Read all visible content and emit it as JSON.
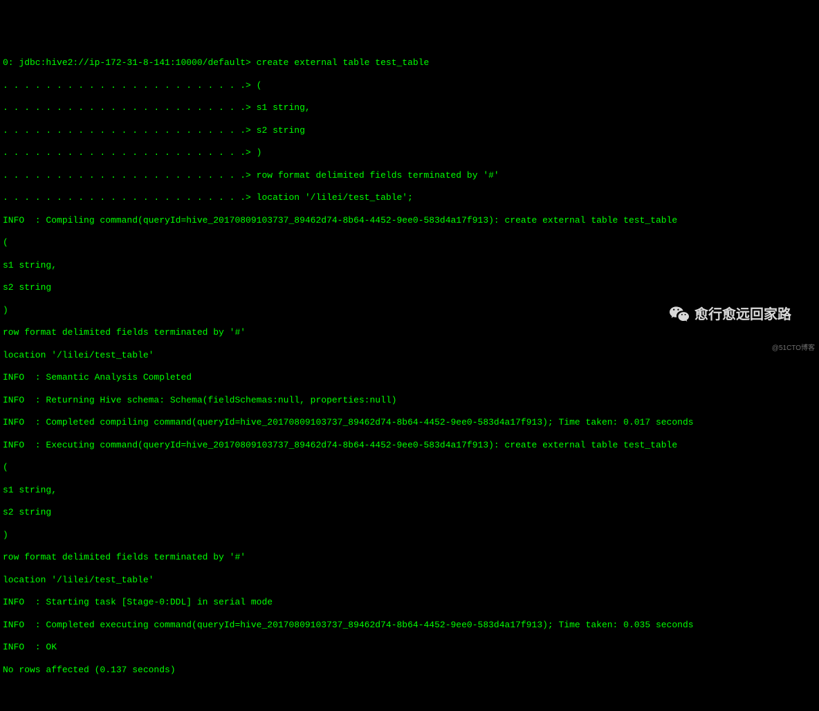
{
  "terminal": {
    "lines": [
      "0: jdbc:hive2://ip-172-31-8-141:10000/default> create external table test_table",
      ". . . . . . . . . . . . . . . . . . . . . . .> (",
      ". . . . . . . . . . . . . . . . . . . . . . .> s1 string,",
      ". . . . . . . . . . . . . . . . . . . . . . .> s2 string",
      ". . . . . . . . . . . . . . . . . . . . . . .> )",
      ". . . . . . . . . . . . . . . . . . . . . . .> row format delimited fields terminated by '#'",
      ". . . . . . . . . . . . . . . . . . . . . . .> location '/lilei/test_table';",
      "INFO  : Compiling command(queryId=hive_20170809103737_89462d74-8b64-4452-9ee0-583d4a17f913): create external table test_table",
      "(",
      "s1 string,",
      "s2 string",
      ")",
      "row format delimited fields terminated by '#'",
      "location '/lilei/test_table'",
      "INFO  : Semantic Analysis Completed",
      "INFO  : Returning Hive schema: Schema(fieldSchemas:null, properties:null)",
      "INFO  : Completed compiling command(queryId=hive_20170809103737_89462d74-8b64-4452-9ee0-583d4a17f913); Time taken: 0.017 seconds",
      "INFO  : Executing command(queryId=hive_20170809103737_89462d74-8b64-4452-9ee0-583d4a17f913): create external table test_table",
      "(",
      "s1 string,",
      "s2 string",
      ")",
      "row format delimited fields terminated by '#'",
      "location '/lilei/test_table'",
      "INFO  : Starting task [Stage-0:DDL] in serial mode",
      "INFO  : Completed executing command(queryId=hive_20170809103737_89462d74-8b64-4452-9ee0-583d4a17f913); Time taken: 0.035 seconds",
      "INFO  : OK",
      "No rows affected (0.137 seconds)"
    ]
  },
  "watermark": {
    "chat_text": "愈行愈远回家路",
    "cto_text": "@51CTO博客"
  }
}
